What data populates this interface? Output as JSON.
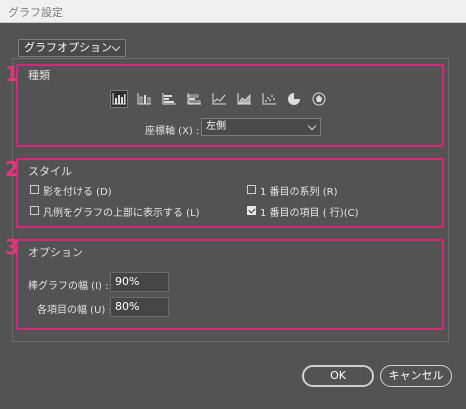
{
  "window": {
    "title": "グラフ設定"
  },
  "top_dropdown": {
    "selected": "グラフオプション"
  },
  "sections": {
    "type": {
      "number": "1",
      "label": "種類"
    },
    "style": {
      "number": "2",
      "label": "スタイル"
    },
    "options": {
      "number": "3",
      "label": "オプション"
    }
  },
  "chart_types": [
    {
      "icon": "grouped-column-icon",
      "selected": true
    },
    {
      "icon": "stacked-column-icon"
    },
    {
      "icon": "grouped-bar-icon"
    },
    {
      "icon": "stacked-bar-icon"
    },
    {
      "icon": "line-chart-icon"
    },
    {
      "icon": "area-chart-icon"
    },
    {
      "icon": "scatter-chart-icon"
    },
    {
      "icon": "pie-chart-icon"
    },
    {
      "icon": "radar-chart-icon"
    }
  ],
  "axis": {
    "label": "座標軸 (X) :",
    "value": "左側"
  },
  "style_options": {
    "shadow": {
      "label": "影を付ける (D)",
      "checked": false
    },
    "legend_top": {
      "label": "凡例をグラフの上部に表示する (L)",
      "checked": false
    },
    "first_series": {
      "label": "1 番目の系列 (R)",
      "checked": false
    },
    "first_item": {
      "label": "1 番目の項目 ( 行)(C)",
      "checked": true
    }
  },
  "option_fields": {
    "bar_width": {
      "label": "棒グラフの幅 (I) :",
      "value": "90%"
    },
    "item_width": {
      "label": "各項目の幅 (U) :",
      "value": "80%"
    }
  },
  "buttons": {
    "ok": "OK",
    "cancel": "キャンセル"
  },
  "colors": {
    "accent": "#d8267a",
    "background": "#535353"
  }
}
